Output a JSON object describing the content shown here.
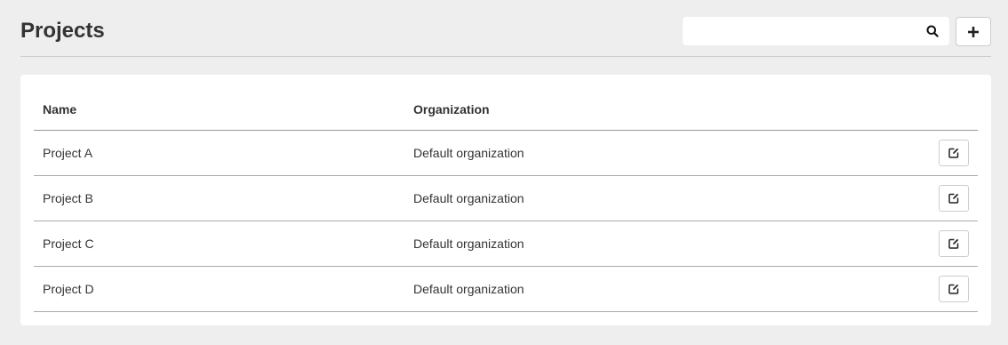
{
  "page": {
    "title": "Projects"
  },
  "search": {
    "value": "",
    "icon": "search-icon"
  },
  "add_button": {
    "icon": "plus-icon"
  },
  "table": {
    "columns": [
      "Name",
      "Organization",
      ""
    ],
    "rows": [
      {
        "name": "Project A",
        "organization": "Default organization"
      },
      {
        "name": "Project B",
        "organization": "Default organization"
      },
      {
        "name": "Project C",
        "organization": "Default organization"
      },
      {
        "name": "Project D",
        "organization": "Default organization"
      }
    ],
    "row_action_icon": "edit-icon"
  },
  "colors": {
    "background": "#eeeeee",
    "card": "#ffffff",
    "text": "#333333",
    "border": "#cccccc"
  }
}
